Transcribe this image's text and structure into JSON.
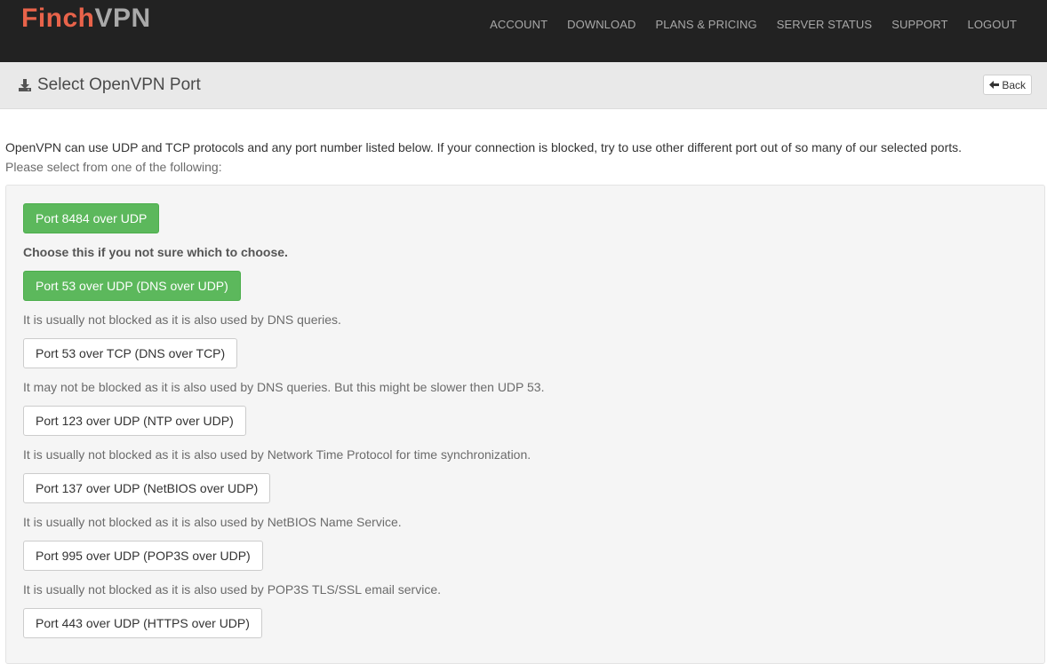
{
  "brand": {
    "part1": "Finch",
    "part2": "VPN"
  },
  "nav": {
    "items": [
      "ACCOUNT",
      "DOWNLOAD",
      "PLANS & PRICING",
      "SERVER STATUS",
      "SUPPORT",
      "LOGOUT"
    ]
  },
  "header": {
    "title": "Select OpenVPN Port",
    "back_label": "Back"
  },
  "intro": {
    "line1": "OpenVPN can use UDP and TCP protocols and any port number listed below. If your connection is blocked, try to use other different port out of so many of our selected ports.",
    "line2": "Please select from one of the following:"
  },
  "options": [
    {
      "label": "Port 8484 over UDP",
      "style": "primary",
      "description": "Choose this if you not sure which to choose."
    },
    {
      "label": "Port 53 over UDP (DNS over UDP)",
      "style": "primary",
      "description": "It is usually not blocked as it is also used by DNS queries."
    },
    {
      "label": "Port 53 over TCP (DNS over TCP)",
      "style": "default",
      "description": "It may not be blocked as it is also used by DNS queries. But this might be slower then UDP 53."
    },
    {
      "label": "Port 123 over UDP (NTP over UDP)",
      "style": "default",
      "description": "It is usually not blocked as it is also used by Network Time Protocol for time synchronization."
    },
    {
      "label": "Port 137 over UDP (NetBIOS over UDP)",
      "style": "default",
      "description": "It is usually not blocked as it is also used by NetBIOS Name Service."
    },
    {
      "label": "Port 995 over UDP (POP3S over UDP)",
      "style": "default",
      "description": "It is usually not blocked as it is also used by POP3S TLS/SSL email service."
    },
    {
      "label": "Port 443 over UDP (HTTPS over UDP)",
      "style": "default",
      "description": ""
    }
  ],
  "colors": {
    "navbar": "#222222",
    "brand_accent": "#e8634a",
    "primary_button": "#5cb85c",
    "header_bar": "#e9e9e9"
  },
  "icons": {
    "title_icon": "download-icon",
    "back_icon": "arrow-left-icon"
  }
}
